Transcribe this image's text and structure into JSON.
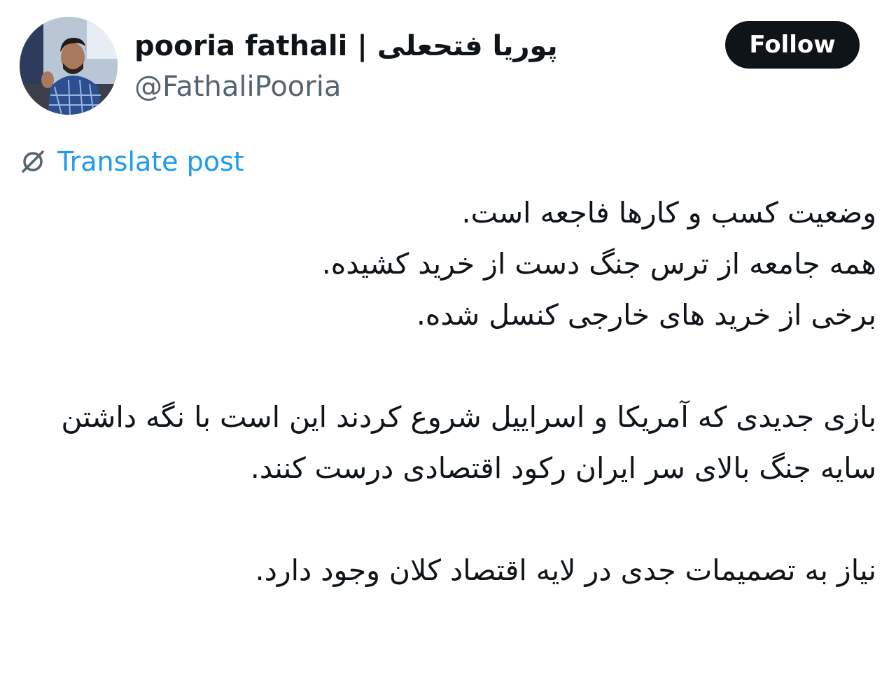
{
  "author": {
    "display_name": "pooria fathali | پوریا فتحعلی",
    "handle": "@FathaliPooria",
    "avatar_icon": "profile-photo"
  },
  "follow_label": "Follow",
  "translate": {
    "label": "Translate post",
    "icon": "translate-globe-icon"
  },
  "post": {
    "paragraph_1": [
      "وضعیت کسب و کارها فاجعه است.",
      "همه جامعه از ترس جنگ دست از خرید کشیده.",
      "برخی از خرید های خارجی کنسل شده."
    ],
    "paragraph_2": "بازی جدیدی که آمریکا و اسراییل شروع کردند این است با نگه داشتن سایه جنگ بالای سر ایران رکود اقتصادی درست کنند.",
    "paragraph_3": "نیاز به تصمیمات جدی در لایه اقتصاد کلان وجود دارد."
  },
  "colors": {
    "text": "#0f1419",
    "secondary": "#536471",
    "link": "#1d9bf0",
    "button_bg": "#0f1419"
  }
}
